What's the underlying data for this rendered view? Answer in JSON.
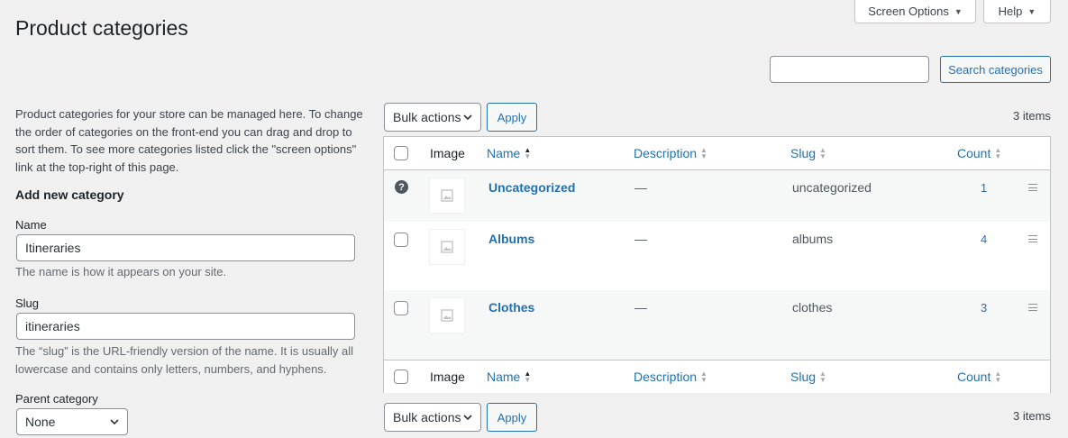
{
  "header": {
    "title": "Product categories",
    "screen_options": "Screen Options",
    "help": "Help"
  },
  "search": {
    "value": "",
    "button": "Search categories"
  },
  "form": {
    "description": "Product categories for your store can be managed here. To change the order of categories on the front-end you can drag and drop to sort them. To see more categories listed click the \"screen options\" link at the top-right of this page.",
    "heading": "Add new category",
    "name_label": "Name",
    "name_value": "Itineraries",
    "name_help": "The name is how it appears on your site.",
    "slug_label": "Slug",
    "slug_value": "itineraries",
    "slug_help_1": "The “slug” is the URL-friendly version of the name. It is usually all",
    "slug_help_2": "lowercase and contains only letters, numbers, and hyphens.",
    "parent_label": "Parent category",
    "parent_value": "None"
  },
  "bulk": {
    "actions": "Bulk actions",
    "apply": "Apply",
    "items": "3 items"
  },
  "table": {
    "columns": {
      "image": "Image",
      "name": "Name",
      "description": "Description",
      "slug": "Slug",
      "count": "Count"
    },
    "rows": [
      {
        "name": "Uncategorized",
        "description": "—",
        "slug": "uncategorized",
        "count": "1"
      },
      {
        "name": "Albums",
        "description": "—",
        "slug": "albums",
        "count": "4"
      },
      {
        "name": "Clothes",
        "description": "—",
        "slug": "clothes",
        "count": "3"
      }
    ]
  },
  "colors": {
    "accent": "#2271b1",
    "background": "#f0f0f1",
    "text": "#3c434a"
  },
  "icons": [
    "caret-down-icon",
    "chevron-down-icon",
    "sort-arrows-icon",
    "help-icon",
    "image-placeholder-icon",
    "drag-handle-icon"
  ]
}
